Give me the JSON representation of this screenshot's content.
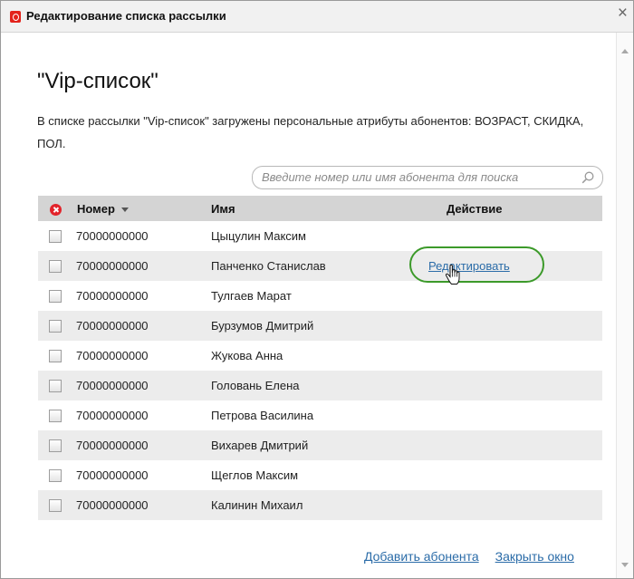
{
  "window": {
    "title": "Редактирование списка рассылки",
    "close_glyph": "×"
  },
  "list": {
    "name": "\"Vip-список\"",
    "description": "В списке рассылки \"Vip-список\" загружены персональные атрибуты абонентов: ВОЗРАСТ, СКИДКА, ПОЛ."
  },
  "search": {
    "placeholder": "Введите номер или имя абонента для поиска"
  },
  "table": {
    "headers": {
      "number": "Номер",
      "name": "Имя",
      "action": "Действие"
    },
    "rows": [
      {
        "number": "70000000000",
        "name": "Цыцулин Максим",
        "action": ""
      },
      {
        "number": "70000000000",
        "name": "Панченко Станислав",
        "action": "Редактировать"
      },
      {
        "number": "70000000000",
        "name": "Тулгаев Марат",
        "action": ""
      },
      {
        "number": "70000000000",
        "name": "Бурзумов Дмитрий",
        "action": ""
      },
      {
        "number": "70000000000",
        "name": "Жукова Анна",
        "action": ""
      },
      {
        "number": "70000000000",
        "name": "Головань Елена",
        "action": ""
      },
      {
        "number": "70000000000",
        "name": "Петрова Василина",
        "action": ""
      },
      {
        "number": "70000000000",
        "name": "Вихарев Дмитрий",
        "action": ""
      },
      {
        "number": "70000000000",
        "name": "Щеглов Максим",
        "action": ""
      },
      {
        "number": "70000000000",
        "name": "Калинин Михаил",
        "action": ""
      }
    ]
  },
  "footer": {
    "add_subscriber": "Добавить абонента",
    "close_window": "Закрыть окно"
  },
  "colors": {
    "brand_red": "#e3231b",
    "link_blue": "#2b6ca8",
    "highlight_green": "#3c9a2a",
    "header_gray": "#d4d4d4",
    "row_alt": "#ececec"
  },
  "icons": {
    "app": "operator-logo-icon",
    "close": "close-icon",
    "search": "search-icon",
    "clear_selection": "cancel-icon",
    "sort": "sort-down-icon",
    "cursor": "hand-cursor-icon"
  }
}
